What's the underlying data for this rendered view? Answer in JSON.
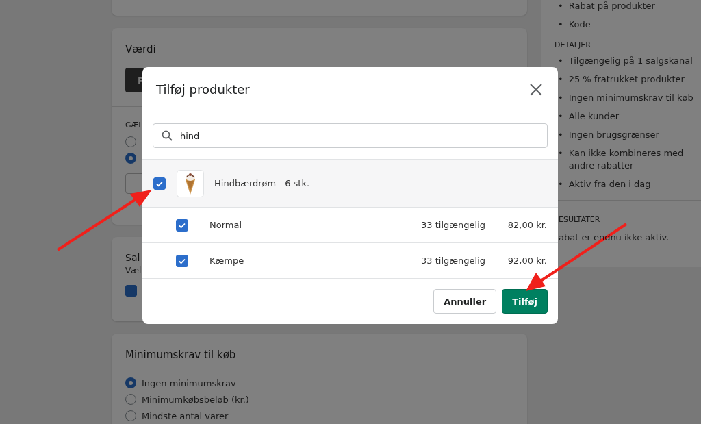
{
  "background": {
    "value_card": {
      "title": "Værdi",
      "button": "P",
      "section_heading": "GÆL",
      "options": [
        {
          "selected": false
        },
        {
          "selected": true
        }
      ]
    },
    "channel_card": {
      "title": "Sal",
      "subtitle": "Væl",
      "checkbox": {
        "checked": true
      }
    },
    "minimum_card": {
      "title": "Minimumskrav til køb",
      "options": [
        {
          "label": "Ingen minimumskrav",
          "selected": true
        },
        {
          "label": "Minimumkøbsbeløb (kr.)",
          "selected": false
        },
        {
          "label": "Mindste antal varer",
          "selected": false
        }
      ]
    },
    "summary": {
      "bullet": "•",
      "top_items": [
        "Rabat på produkter",
        "Kode"
      ],
      "details_heading": "DETALJER",
      "details": [
        "Tilgængelig på 1 salgskanal",
        "25 % fratrukket produkter",
        "Ingen minimumskrav til køb",
        "Alle kunder",
        "Ingen brugsgrænser",
        "Kan ikke kombineres med andre rabatter",
        "Aktiv fra den i dag"
      ],
      "results_heading": "ESULTATER",
      "results_text": "abat er endnu ikke aktiv."
    }
  },
  "dialog": {
    "title": "Tilføj produkter",
    "search": {
      "value": "hind"
    },
    "product": {
      "name": "Hindbærdrøm - 6 stk.",
      "checked": true,
      "variants": [
        {
          "name": "Normal",
          "available": "33 tilgængelig",
          "price": "82,00 kr.",
          "checked": true
        },
        {
          "name": "Kæmpe",
          "available": "33 tilgængelig",
          "price": "92,00 kr.",
          "checked": true
        }
      ]
    },
    "buttons": [
      {
        "label": "Annuller",
        "kind": "secondary"
      },
      {
        "label": "Tilføj",
        "kind": "primary"
      }
    ]
  }
}
